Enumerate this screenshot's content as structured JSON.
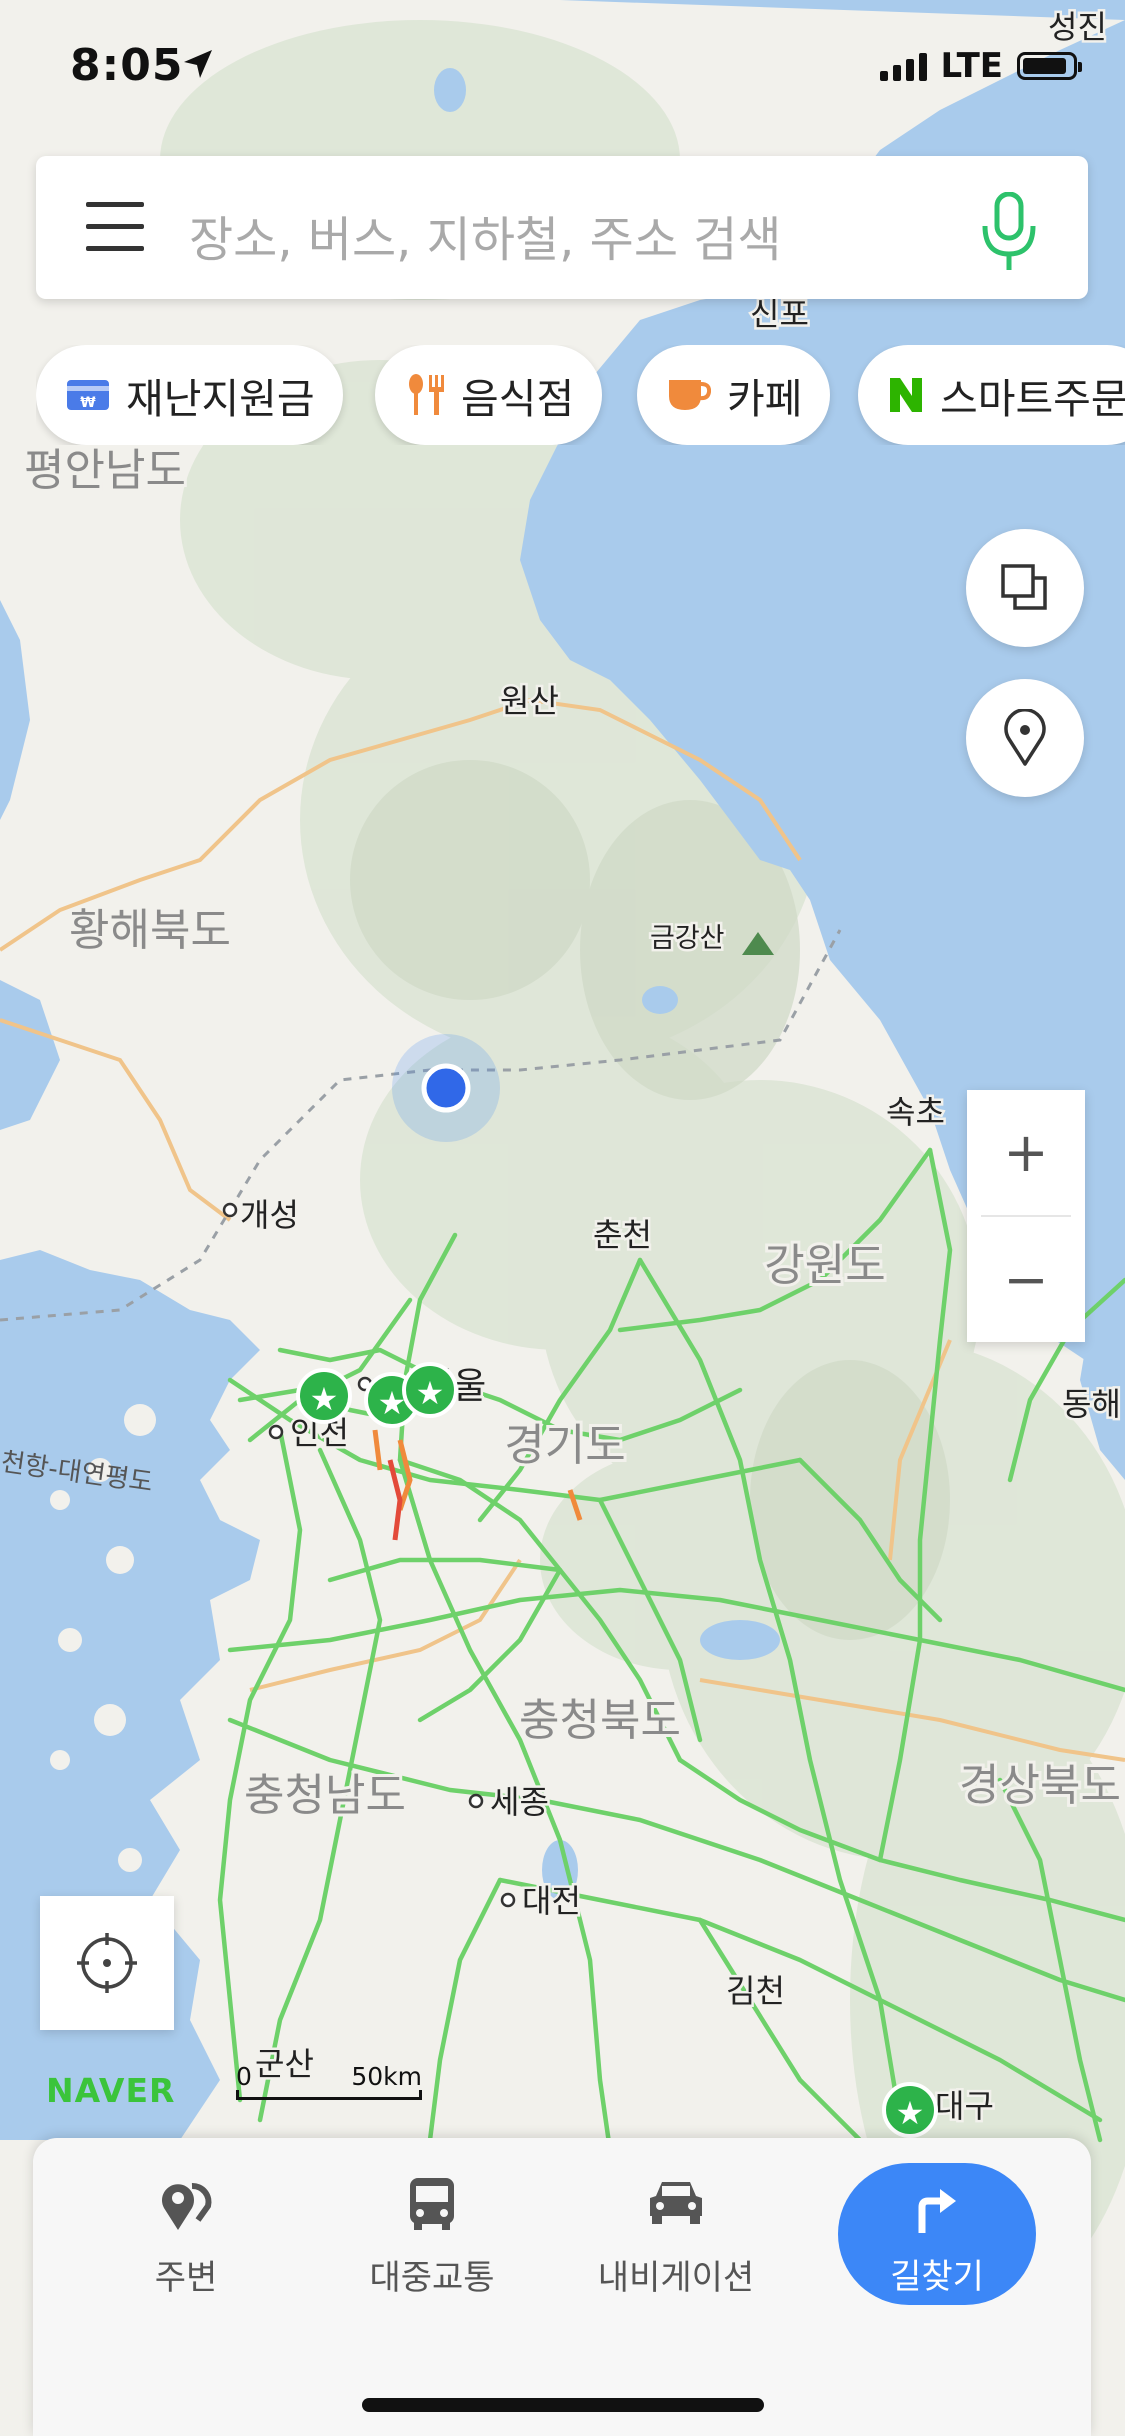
{
  "status_bar": {
    "time": "8:05",
    "network": "LTE"
  },
  "search": {
    "placeholder": "장소, 버스, 지하철, 주소 검색"
  },
  "chips": [
    {
      "label": "재난지원금",
      "icon": "card-icon",
      "color": "#4a7be8"
    },
    {
      "label": "음식점",
      "icon": "fork-knife-icon",
      "color": "#f08a3c"
    },
    {
      "label": "카페",
      "icon": "coffee-cup-icon",
      "color": "#f08a3c"
    },
    {
      "label": "스마트주문",
      "icon": "naver-n-icon",
      "color": "#2db400"
    }
  ],
  "map": {
    "regions": [
      "평안남도",
      "황해북도",
      "강원도",
      "경기도",
      "충청북도",
      "충청남도",
      "경상북도"
    ],
    "cities": [
      "성진",
      "신포",
      "원산",
      "금강산",
      "속초",
      "개성",
      "춘천",
      "서울",
      "인천",
      "동해",
      "세종",
      "대전",
      "김천",
      "대구",
      "군산"
    ],
    "sea_route": "천항-대연평도",
    "colors": {
      "land": "#f2f1ec",
      "mountain": "#d6dfcf",
      "sea": "#a9cbec",
      "road": "#6ed16a",
      "province_border": "#f0c48a"
    }
  },
  "brand": "NAVER",
  "scale": {
    "zero": "0",
    "distance": "50km"
  },
  "zoom": {
    "in": "+",
    "out": "−"
  },
  "bottom_nav": {
    "items": [
      {
        "label": "주변",
        "icon": "nearby-pin-icon"
      },
      {
        "label": "대중교통",
        "icon": "bus-icon"
      },
      {
        "label": "내비게이션",
        "icon": "car-icon"
      }
    ],
    "route": {
      "label": "길찾기",
      "icon": "turn-right-arrow-icon",
      "color": "#3c87f7"
    }
  }
}
